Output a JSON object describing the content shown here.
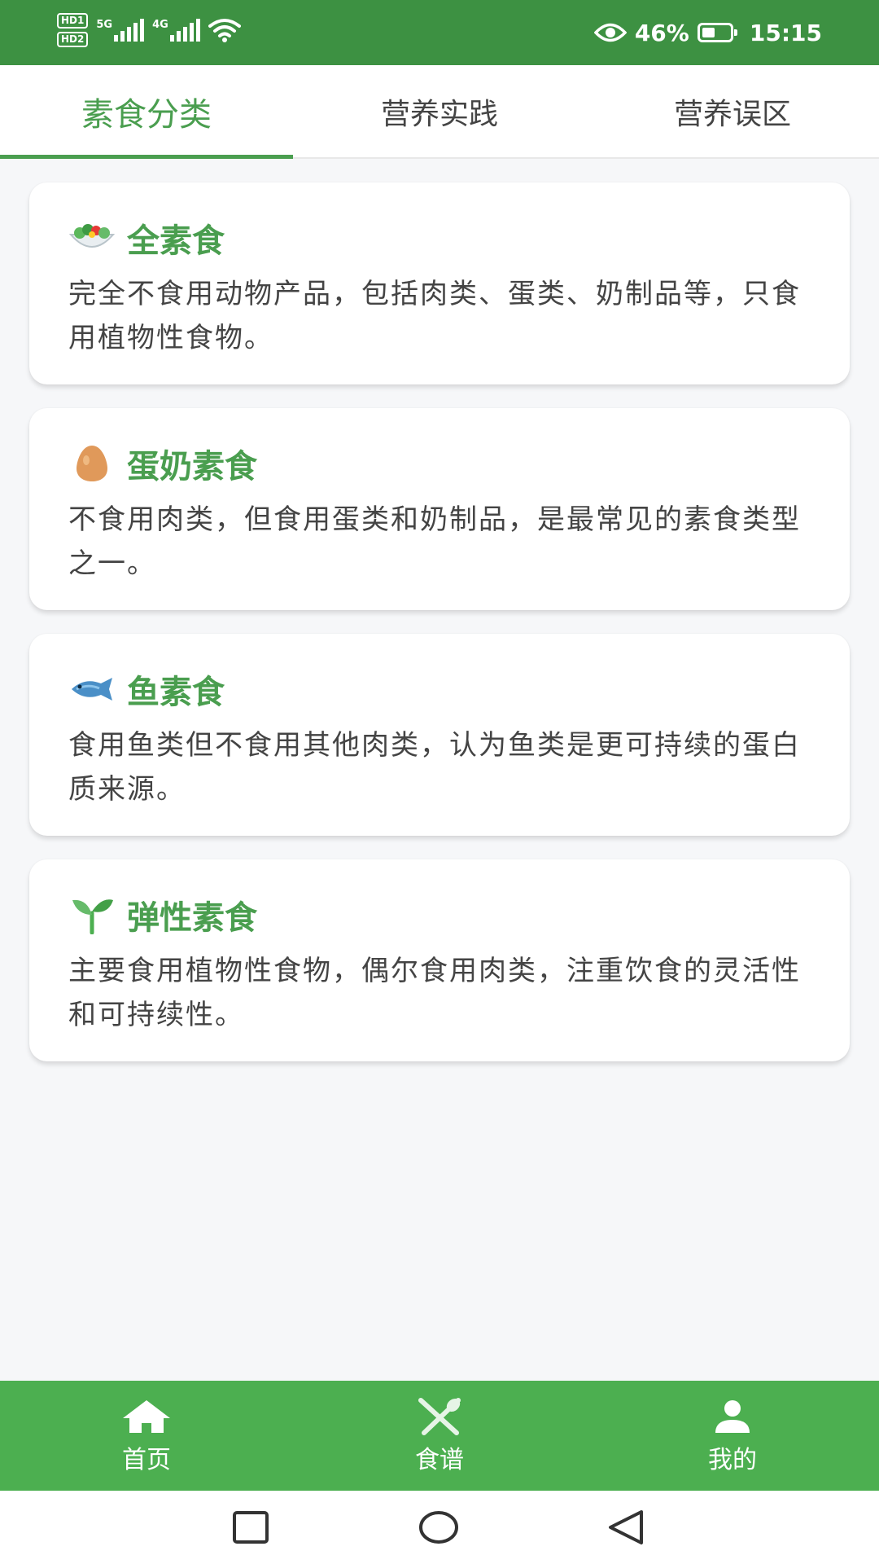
{
  "status_bar": {
    "hd1": "HD1",
    "hd2": "HD2",
    "net1": "5G",
    "net2": "4G",
    "battery_percent": "46%",
    "battery_level": 0.46,
    "time": "15:15",
    "icons": [
      "signal-icon",
      "wifi-icon",
      "eye-icon",
      "battery-icon"
    ]
  },
  "tabs": [
    {
      "label": "素食分类",
      "active": true
    },
    {
      "label": "营养实践",
      "active": false
    },
    {
      "label": "营养误区",
      "active": false
    }
  ],
  "cards": [
    {
      "icon": "salad-icon",
      "title": "全素食",
      "description": "完全不食用动物产品，包括肉类、蛋类、奶制品等，只食用植物性食物。"
    },
    {
      "icon": "egg-icon",
      "title": "蛋奶素食",
      "description": "不食用肉类，但食用蛋类和奶制品，是最常见的素食类型之一。"
    },
    {
      "icon": "fish-icon",
      "title": "鱼素食",
      "description": "食用鱼类但不食用其他肉类，认为鱼类是更可持续的蛋白质来源。"
    },
    {
      "icon": "seedling-icon",
      "title": "弹性素食",
      "description": "主要食用植物性食物，偶尔食用肉类，注重饮食的灵活性和可持续性。"
    }
  ],
  "bottom_nav": [
    {
      "icon": "home-icon",
      "label": "首页"
    },
    {
      "icon": "utensils-icon",
      "label": "食谱"
    },
    {
      "icon": "user-icon",
      "label": "我的"
    }
  ],
  "colors": {
    "status_bar": "#3d9142",
    "accent": "#4a9e4f",
    "bottom_nav": "#4caf50",
    "background": "#f6f7f9"
  }
}
